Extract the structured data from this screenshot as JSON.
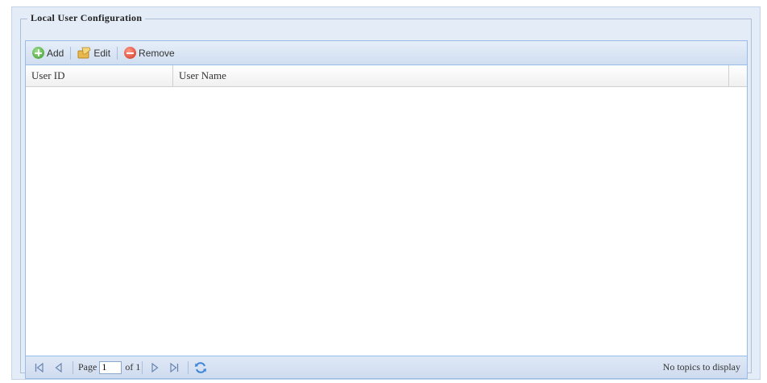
{
  "fieldset": {
    "legend": "Local User Configuration"
  },
  "toolbar": {
    "add_label": "Add",
    "edit_label": "Edit",
    "remove_label": "Remove"
  },
  "grid": {
    "columns": [
      "User ID",
      "User Name"
    ],
    "rows": []
  },
  "pager": {
    "page_label": "Page",
    "page_value": "1",
    "of_label": "of 1",
    "status": "No topics to display"
  }
}
